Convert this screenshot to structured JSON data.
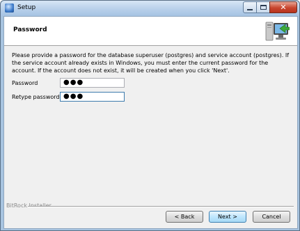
{
  "window": {
    "title": "Setup",
    "icons": {
      "app": "setup-app-icon",
      "minimize": "minimize-icon",
      "maximize": "maximize-icon",
      "close": "close-icon"
    }
  },
  "header": {
    "title": "Password",
    "graphic": "computer-arrow-icon"
  },
  "body": {
    "instructions": "Please provide a password for the database superuser (postgres) and service account (postgres). If the service account already exists in Windows, you must enter the current password for the account. If the account does not exist, it will be created when you click 'Next'.",
    "fields": [
      {
        "label": "Password",
        "value": "●●●"
      },
      {
        "label": "Retype password",
        "value": "●●●"
      }
    ]
  },
  "footer": {
    "installer_label": "BitRock Installer",
    "back_label": "< Back",
    "next_label": "Next >",
    "cancel_label": "Cancel"
  }
}
